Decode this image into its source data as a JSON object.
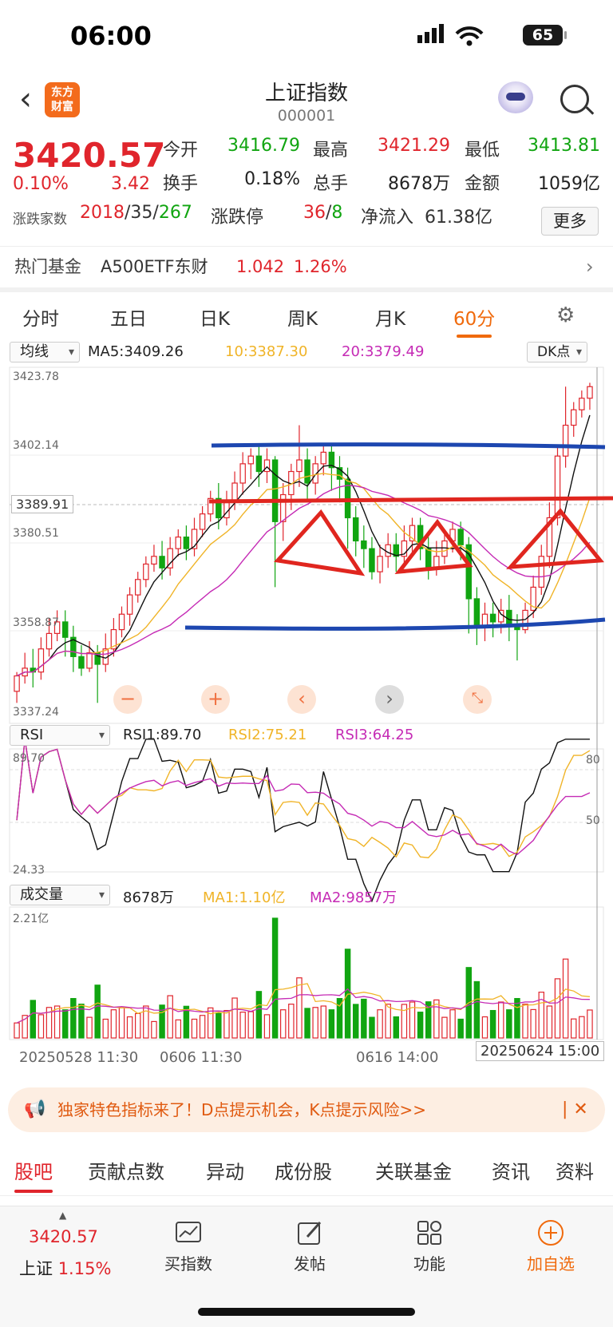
{
  "status_bar": {
    "time": "06:00",
    "battery": "65"
  },
  "nav": {
    "title": "上证指数",
    "code": "000001",
    "logo": "东方\n财富"
  },
  "quote": {
    "price": "3420.57",
    "change_pct": "0.10%",
    "change": "3.42",
    "open_label": "今开",
    "open": "3416.79",
    "high_label": "最高",
    "high": "3421.29",
    "low_label": "最低",
    "low": "3413.81",
    "turnover_label": "换手",
    "turnover": "0.18%",
    "volume_label": "总手",
    "volume": "8678万",
    "amount_label": "金额",
    "amount": "1059亿",
    "updown_label": "涨跌家数",
    "up": "2018",
    "flat": "35",
    "down": "267",
    "limit_label": "涨跌停",
    "limit_up": "36",
    "limit_down": "8",
    "inflow_label": "净流入",
    "inflow": "61.38亿",
    "more": "更多"
  },
  "hot_fund": {
    "label": "热门基金",
    "name": "A500ETF东财",
    "price": "1.042",
    "pct": "1.26%"
  },
  "period_tabs": [
    "分时",
    "五日",
    "日K",
    "周K",
    "月K",
    "60分"
  ],
  "active_period": "60分",
  "main_indicator": {
    "select": "均线",
    "ma5": "MA5:3409.26",
    "ma10": "10:3387.30",
    "ma20": "20:3379.49",
    "dk": "DK点",
    "y_labels": [
      "3423.78",
      "3402.14",
      "3389.91",
      "3380.51",
      "3358.87",
      "3337.24"
    ]
  },
  "rsi": {
    "select": "RSI",
    "rsi1": "RSI1:89.70",
    "rsi2": "RSI2:75.21",
    "rsi3": "RSI3:64.25",
    "top": "89.70",
    "bottom": "24.33",
    "r80": "80",
    "r50": "50"
  },
  "volume_panel": {
    "select": "成交量",
    "vol": "8678万",
    "ma1": "MA1:1.10亿",
    "ma2": "MA2:9857万",
    "top": "2.21亿"
  },
  "x_axis": [
    "20250528 11:30",
    "0606 11:30",
    "0616 14:00",
    "20250624 15:00"
  ],
  "banner": {
    "text": "独家特色指标来了！D点提示机会，K点提示风险>>"
  },
  "lower_tabs": [
    "股吧",
    "贡献点数",
    "异动",
    "成份股",
    "关联基金",
    "资讯",
    "资料"
  ],
  "bottom_bar": {
    "index_price": "3420.57",
    "index_name": "上证",
    "index_pct": "1.15%",
    "buy": "买指数",
    "post": "发帖",
    "func": "功能",
    "add": "加自选"
  },
  "chart_data": {
    "type": "candlestick",
    "ylim": [
      3337.24,
      3423.78
    ],
    "candles": [
      [
        3341,
        3345,
        3338,
        3346
      ],
      [
        3345,
        3347,
        3343,
        3351
      ],
      [
        3347,
        3346,
        3342,
        3352
      ],
      [
        3346,
        3352,
        3344,
        3355
      ],
      [
        3352,
        3356,
        3350,
        3360
      ],
      [
        3356,
        3359,
        3354,
        3362
      ],
      [
        3359,
        3355,
        3350,
        3362
      ],
      [
        3355,
        3350,
        3346,
        3358
      ],
      [
        3350,
        3347,
        3345,
        3353
      ],
      [
        3347,
        3351,
        3346,
        3354
      ],
      [
        3351,
        3348,
        3338,
        3353
      ],
      [
        3348,
        3352,
        3346,
        3356
      ],
      [
        3352,
        3357,
        3350,
        3360
      ],
      [
        3357,
        3361,
        3355,
        3363
      ],
      [
        3361,
        3366,
        3358,
        3368
      ],
      [
        3366,
        3370,
        3364,
        3372
      ],
      [
        3370,
        3374,
        3368,
        3376
      ],
      [
        3374,
        3376,
        3372,
        3379
      ],
      [
        3376,
        3373,
        3370,
        3380
      ],
      [
        3373,
        3378,
        3371,
        3381
      ],
      [
        3378,
        3381,
        3376,
        3383
      ],
      [
        3381,
        3378,
        3375,
        3384
      ],
      [
        3378,
        3383,
        3376,
        3386
      ],
      [
        3383,
        3387,
        3381,
        3389
      ],
      [
        3387,
        3391,
        3385,
        3393
      ],
      [
        3391,
        3386,
        3383,
        3395
      ],
      [
        3386,
        3390,
        3384,
        3393
      ],
      [
        3390,
        3395,
        3388,
        3398
      ],
      [
        3395,
        3400,
        3392,
        3403
      ],
      [
        3400,
        3402,
        3396,
        3404
      ],
      [
        3402,
        3398,
        3394,
        3405
      ],
      [
        3398,
        3401,
        3395,
        3404
      ],
      [
        3401,
        3385,
        3368,
        3402
      ],
      [
        3385,
        3392,
        3380,
        3395
      ],
      [
        3392,
        3398,
        3388,
        3400
      ],
      [
        3398,
        3401,
        3394,
        3410
      ],
      [
        3401,
        3395,
        3390,
        3404
      ],
      [
        3395,
        3400,
        3392,
        3402
      ],
      [
        3400,
        3403,
        3397,
        3405
      ],
      [
        3403,
        3399,
        3393,
        3405
      ],
      [
        3399,
        3396,
        3390,
        3402
      ],
      [
        3396,
        3386,
        3378,
        3399
      ],
      [
        3386,
        3380,
        3376,
        3389
      ],
      [
        3380,
        3378,
        3373,
        3384
      ],
      [
        3378,
        3372,
        3370,
        3381
      ],
      [
        3372,
        3376,
        3369,
        3379
      ],
      [
        3376,
        3379,
        3373,
        3382
      ],
      [
        3379,
        3376,
        3372,
        3382
      ],
      [
        3376,
        3380,
        3373,
        3384
      ],
      [
        3380,
        3384,
        3377,
        3386
      ],
      [
        3384,
        3378,
        3375,
        3386
      ],
      [
        3378,
        3373,
        3370,
        3381
      ],
      [
        3373,
        3376,
        3371,
        3380
      ],
      [
        3376,
        3380,
        3374,
        3382
      ],
      [
        3380,
        3383,
        3377,
        3385
      ],
      [
        3383,
        3379,
        3375,
        3385
      ],
      [
        3379,
        3365,
        3356,
        3381
      ],
      [
        3365,
        3358,
        3353,
        3368
      ],
      [
        3358,
        3361,
        3354,
        3364
      ],
      [
        3361,
        3359,
        3355,
        3364
      ],
      [
        3359,
        3362,
        3356,
        3365
      ],
      [
        3362,
        3358,
        3354,
        3366
      ],
      [
        3358,
        3357,
        3349,
        3361
      ],
      [
        3357,
        3362,
        3356,
        3364
      ],
      [
        3362,
        3368,
        3360,
        3371
      ],
      [
        3368,
        3376,
        3366,
        3379
      ],
      [
        3376,
        3386,
        3373,
        3390
      ],
      [
        3386,
        3402,
        3384,
        3405
      ],
      [
        3402,
        3410,
        3399,
        3420
      ],
      [
        3410,
        3414,
        3407,
        3416
      ],
      [
        3414,
        3417,
        3412,
        3419
      ],
      [
        3417,
        3420,
        3414,
        3421
      ]
    ]
  }
}
